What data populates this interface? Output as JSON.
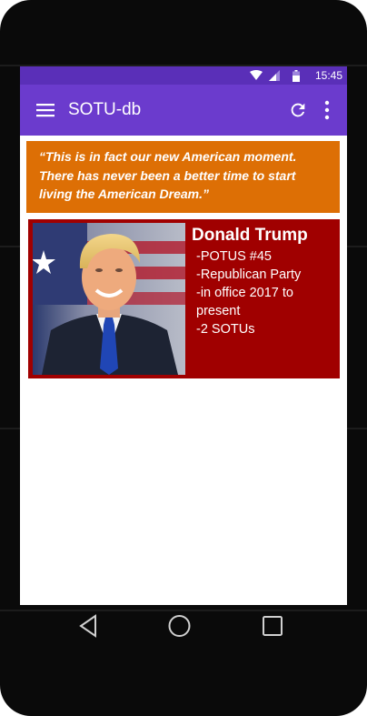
{
  "status_bar": {
    "time": "15:45",
    "icons": [
      "wifi-icon",
      "cell-signal-icon",
      "battery-icon"
    ]
  },
  "app_bar": {
    "title": "SOTU-db",
    "icons": [
      "menu-icon",
      "refresh-icon",
      "more-vert-icon"
    ]
  },
  "quote": {
    "text": "“This is in fact our new American moment. There has never been a better time to start living the American Dream.”"
  },
  "president": {
    "name": "Donald Trump",
    "details": [
      "-POTUS #45",
      "-Republican Party",
      "-in office 2017 to present",
      "-2 SOTUs"
    ],
    "portrait_icon": "president-portrait"
  },
  "nav_bar": {
    "icons": [
      "back-icon",
      "home-icon",
      "recents-icon"
    ]
  },
  "colors": {
    "status_bar": "#5a2fb8",
    "app_bar": "#6b3bcd",
    "quote_bg": "#dd6f05",
    "card_bg": "#a00000",
    "frame": "#0a0a0a"
  }
}
